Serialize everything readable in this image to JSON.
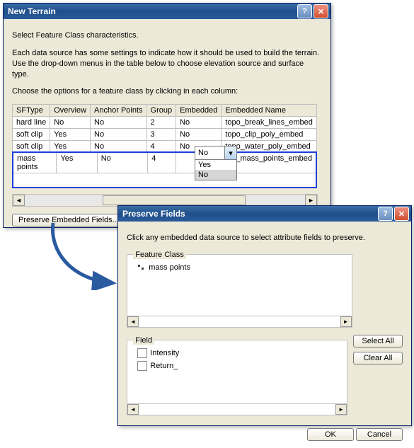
{
  "dialog1": {
    "title": "New Terrain",
    "intro": "Select Feature Class characteristics.",
    "desc": "Each data source has some settings to indicate how it should be used to build the terrain.  Use the drop-down menus in the table below to choose elevation source and surface type.",
    "choose": "Choose the options for a feature class by clicking in each column:",
    "headers": {
      "sftype": "SFType",
      "overview": "Overview",
      "anchor": "Anchor Points",
      "group": "Group",
      "embedded": "Embedded",
      "ename": "Embedded Name"
    },
    "rows": [
      {
        "sftype": "hard line",
        "overview": "No",
        "anchor": "No",
        "group": "2",
        "embedded": "No",
        "ename": "topo_break_lines_embed"
      },
      {
        "sftype": "soft clip",
        "overview": "Yes",
        "anchor": "No",
        "group": "3",
        "embedded": "No",
        "ename": "topo_clip_poly_embed"
      },
      {
        "sftype": "soft clip",
        "overview": "Yes",
        "anchor": "No",
        "group": "4",
        "embedded": "No",
        "ename": "topo_water_poly_embed"
      },
      {
        "sftype": "mass points",
        "overview": "Yes",
        "anchor": "No",
        "group": "4",
        "embedded": "No",
        "ename": "topo_mass_points_embed"
      }
    ],
    "dropdown": {
      "selected": "No",
      "opt_yes": "Yes",
      "opt_no": "No"
    },
    "preserve_btn": "Preserve Embedded Fields..."
  },
  "dialog2": {
    "title": "Preserve Fields",
    "instr": "Click any embedded data source to select attribute fields to preserve.",
    "fc_label": "Feature Class",
    "fc_item": "mass points",
    "field_label": "Field",
    "field_items": {
      "a": "Intensity",
      "b": "Return_"
    },
    "select_all": "Select All",
    "clear_all": "Clear All",
    "ok": "OK",
    "cancel": "Cancel"
  }
}
